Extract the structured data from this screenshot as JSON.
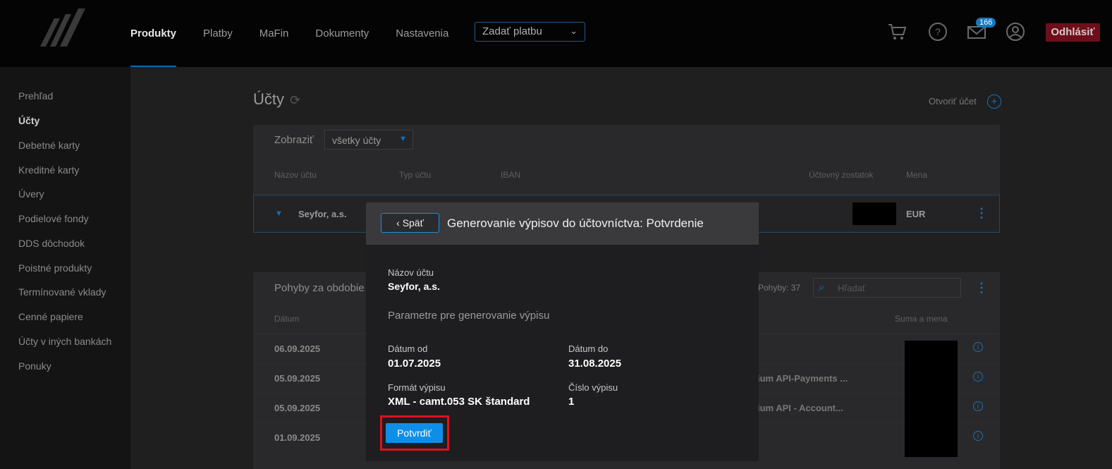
{
  "nav": {
    "items": [
      "Produkty",
      "Platby",
      "MaFin",
      "Dokumenty",
      "Nastavenia"
    ],
    "pay_select": "Zadať platbu",
    "mail_badge": "166",
    "logout": "Odhlásiť"
  },
  "sidebar": {
    "items": [
      "Prehľad",
      "Účty",
      "Debetné karty",
      "Kreditné karty",
      "Úvery",
      "Podielové fondy",
      "DDS dôchodok",
      "Poistné produkty",
      "Termínované vklady",
      "Cenné papiere",
      "Účty v iných bankách",
      "Ponuky"
    ]
  },
  "page": {
    "title": "Účty",
    "open_account": "Otvoriť účet",
    "show_label": "Zobraziť",
    "show_value": "všetky účty",
    "columns": [
      "Názov účtu",
      "Typ účtu",
      "IBAN",
      "Účtovný zostatok",
      "Mena"
    ],
    "account_name": "Seyfor, a.s.",
    "account_currency": "EUR"
  },
  "movements": {
    "title": "Pohyby za obdobie",
    "count": "Pohyby: 37",
    "search_placeholder": "Hľadať",
    "col_date": "Dátum",
    "col_sum": "Suma a mena",
    "rows": [
      {
        "date": "06.09.2025",
        "desc": ""
      },
      {
        "date": "05.09.2025",
        "desc": "ium API-Payments ..."
      },
      {
        "date": "05.09.2025",
        "desc": "ium API - Account..."
      },
      {
        "date": "01.09.2025",
        "desc": ""
      }
    ]
  },
  "modal": {
    "back": "Späť",
    "title": "Generovanie výpisov do účtovníctva: Potvrdenie",
    "account_label": "Názov účtu",
    "account_value": "Seyfor, a.s.",
    "section": "Parametre pre generovanie výpisu",
    "date_from_label": "Dátum od",
    "date_from": "01.07.2025",
    "date_to_label": "Dátum do",
    "date_to": "31.08.2025",
    "format_label": "Formát výpisu",
    "format_value": "XML - camt.053 SK štandard",
    "number_label": "Číslo výpisu",
    "number_value": "1",
    "confirm": "Potvrdiť"
  },
  "colors": {
    "accent": "#0f8ee8",
    "highlight": "#e0101e",
    "logout": "#6d0f1b"
  }
}
